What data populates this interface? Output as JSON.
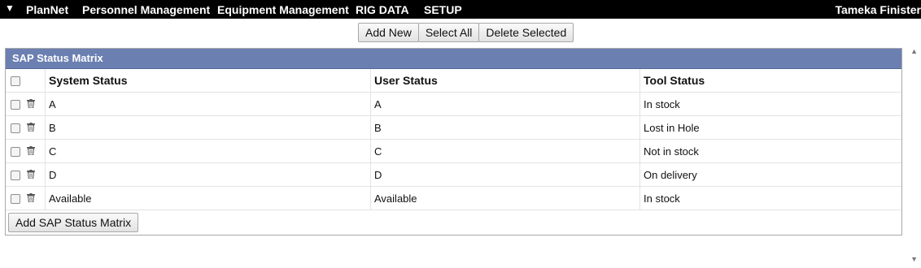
{
  "nav": {
    "menu_icon": "caret-down-icon",
    "items": [
      "PlanNet",
      "Personnel Management",
      "Equipment Management",
      "RIG DATA",
      "SETUP"
    ],
    "user": "Tameka Finister"
  },
  "toolbar": {
    "add_new": "Add New",
    "select_all": "Select All",
    "delete_selected": "Delete Selected"
  },
  "panel": {
    "title": "SAP Status Matrix",
    "columns": [
      "System Status",
      "User Status",
      "Tool Status"
    ],
    "rows": [
      {
        "system": "A",
        "user": "A",
        "tool": "In stock"
      },
      {
        "system": "B",
        "user": "B",
        "tool": "Lost in Hole"
      },
      {
        "system": "C",
        "user": "C",
        "tool": "Not in stock"
      },
      {
        "system": "D",
        "user": "D",
        "tool": "On delivery"
      },
      {
        "system": "Available",
        "user": "Available",
        "tool": "In stock"
      }
    ],
    "add_button": "Add SAP Status Matrix"
  },
  "colors": {
    "nav_bg": "#000000",
    "panel_header_bg": "#6b7fb1"
  }
}
